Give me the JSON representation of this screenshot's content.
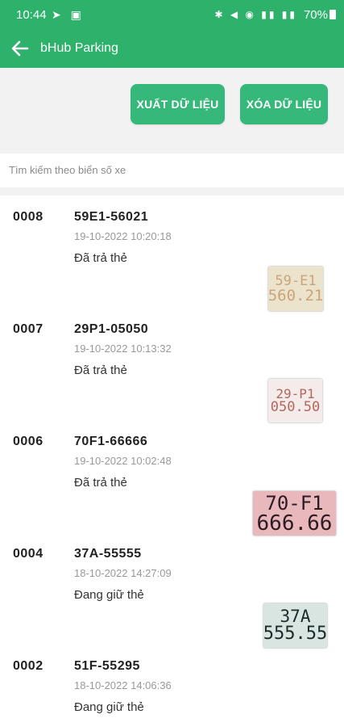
{
  "status_bar": {
    "time": "10:44",
    "battery": "70%"
  },
  "app": {
    "title": "bHub Parking"
  },
  "actions": {
    "export_label": "XUẤT DỮ LIỆU",
    "delete_label": "XÓA DỮ LIỆU"
  },
  "search": {
    "placeholder": "Tìm kiếm theo biển số xe",
    "value": ""
  },
  "records": [
    {
      "id": "0008",
      "plate": "59E1-56021",
      "time": "19-10-2022 10:20:18",
      "status": "Đã trả thẻ",
      "plate_image": {
        "line1": "59-E1",
        "line2": "560.21",
        "bg": "#ece3cd",
        "fg": "#caa57a"
      }
    },
    {
      "id": "0007",
      "plate": "29P1-05050",
      "time": "19-10-2022 10:13:32",
      "status": "Đã trả thẻ",
      "plate_image": {
        "line1": "29-P1",
        "line2": "050.50",
        "bg": "#f4ecea",
        "fg": "#b6665e"
      }
    },
    {
      "id": "0006",
      "plate": "70F1-66666",
      "time": "19-10-2022 10:02:48",
      "status": "Đã trả thẻ",
      "plate_image": {
        "line1": "70-F1",
        "line2": "666.66",
        "bg": "#e9b8bd",
        "fg": "#2b1d22"
      }
    },
    {
      "id": "0004",
      "plate": "37A-55555",
      "time": "18-10-2022 14:27:09",
      "status": "Đang giữ thẻ",
      "plate_image": {
        "line1": "37A",
        "line2": "555.55",
        "bg": "#d9e5e1",
        "fg": "#1d2a2a"
      }
    },
    {
      "id": "0002",
      "plate": "51F-55295",
      "time": "18-10-2022 14:06:36",
      "status": "Đang giữ thẻ"
    }
  ]
}
